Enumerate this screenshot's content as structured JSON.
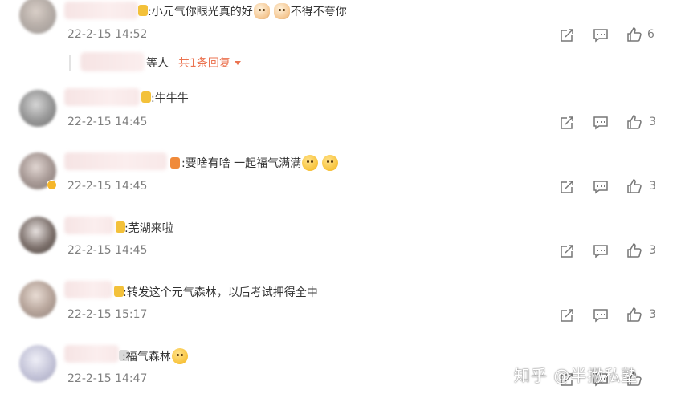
{
  "comments": [
    {
      "text": ":小元气你眼光真的好",
      "text_after": "不得不夸你",
      "time": "22-2-15 14:52",
      "likes": "6",
      "emojis": [
        "cat-face-emoji",
        "cat-face-emoji"
      ]
    },
    {
      "text": ":牛牛牛",
      "time": "22-2-15 14:45",
      "likes": "3"
    },
    {
      "text": ":要啥有啥 一起福气满满",
      "time": "22-2-15 14:45",
      "likes": "3",
      "emojis": [
        "surprised-face-emoji",
        "surprised-face-emoji"
      ]
    },
    {
      "text": ":芜湖来啦",
      "time": "22-2-15 14:45",
      "likes": "3"
    },
    {
      "text": ":转发这个元气森林，以后考试押得全中",
      "time": "22-2-15 15:17",
      "likes": "3"
    },
    {
      "text": ":福气森林",
      "time": "22-2-15 14:47",
      "likes": "",
      "emojis": [
        "smile-face-emoji"
      ]
    }
  ],
  "reply_summary": {
    "others_label": "等人",
    "count_link": "共1条回复"
  },
  "watermark": "知乎 @半撇私塾",
  "colors": {
    "accent": "#eb7350",
    "timestamp": "#808080",
    "text": "#333333"
  },
  "icons": {
    "forward": "share-arrow-icon",
    "comment": "comment-bubble-icon",
    "like": "thumbs-up-icon"
  }
}
